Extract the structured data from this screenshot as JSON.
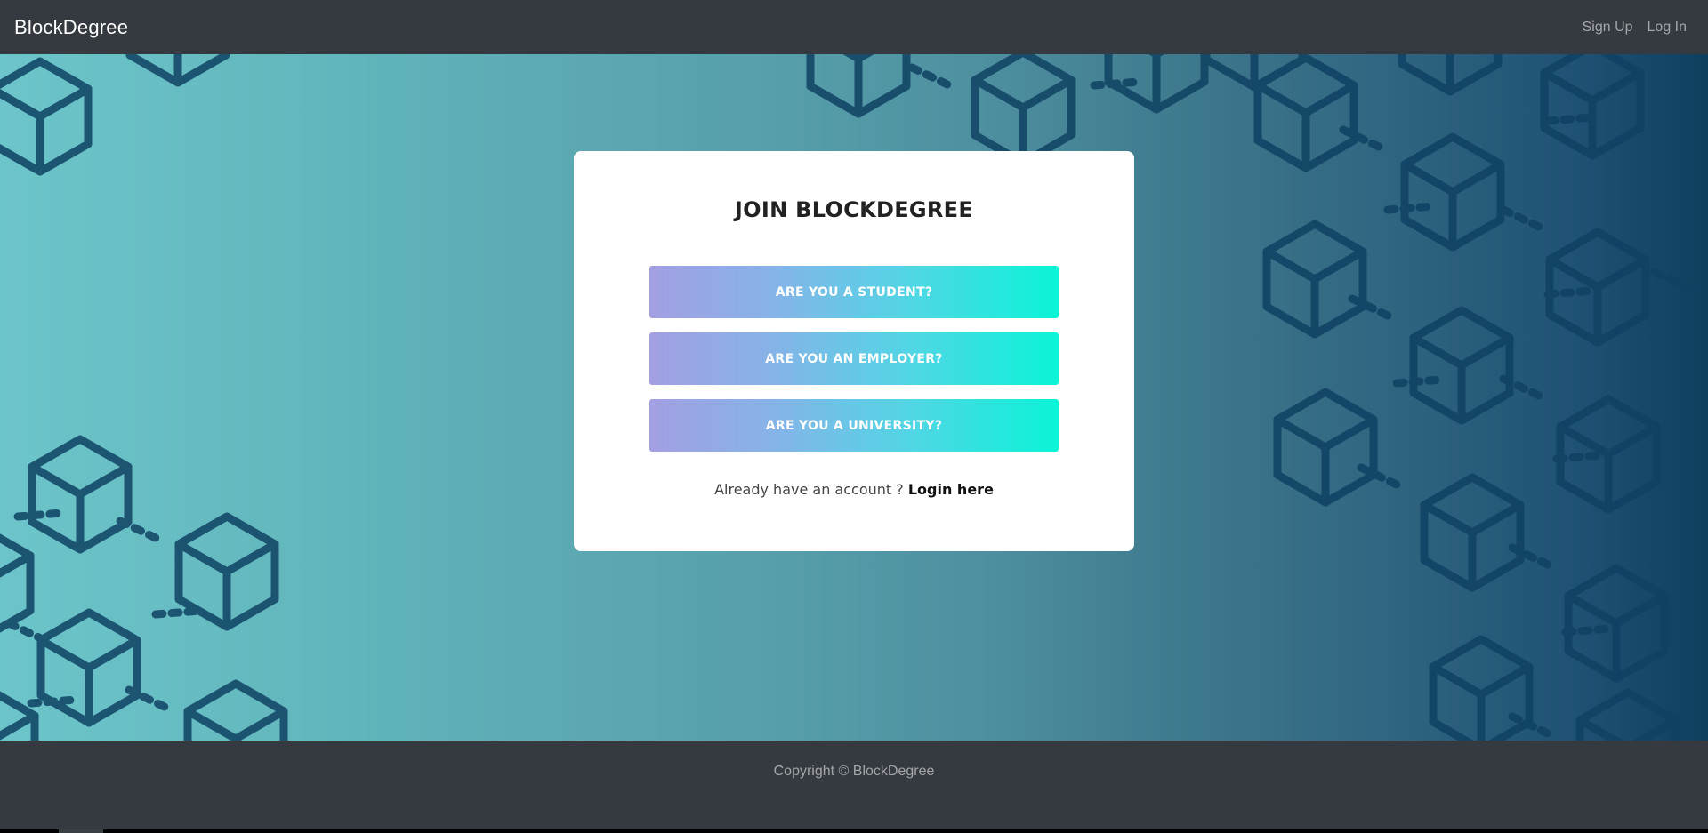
{
  "navbar": {
    "brand": "BlockDegree",
    "links": [
      {
        "label": "Sign Up"
      },
      {
        "label": "Log In"
      }
    ]
  },
  "card": {
    "title": "JOIN BLOCKDEGREE",
    "buttons": {
      "student": "ARE YOU A STUDENT?",
      "employer": "ARE YOU AN EMPLOYER?",
      "university": "ARE YOU A UNIVERSITY?"
    },
    "login_prompt": "Already have an account ? ",
    "login_link": "Login here"
  },
  "footer": {
    "copyright": "Copyright © BlockDegree"
  },
  "colors": {
    "navbar_bg": "#343a40",
    "hero_gradient_start": "#6cc5ca",
    "hero_gradient_end": "#0e3f5f",
    "cube_stroke": "#0f4163",
    "button_gradient_start": "#a39fe3",
    "button_gradient_end": "#0af4d7"
  },
  "icons": {
    "background_pattern": "blockchain-cube-icon"
  }
}
